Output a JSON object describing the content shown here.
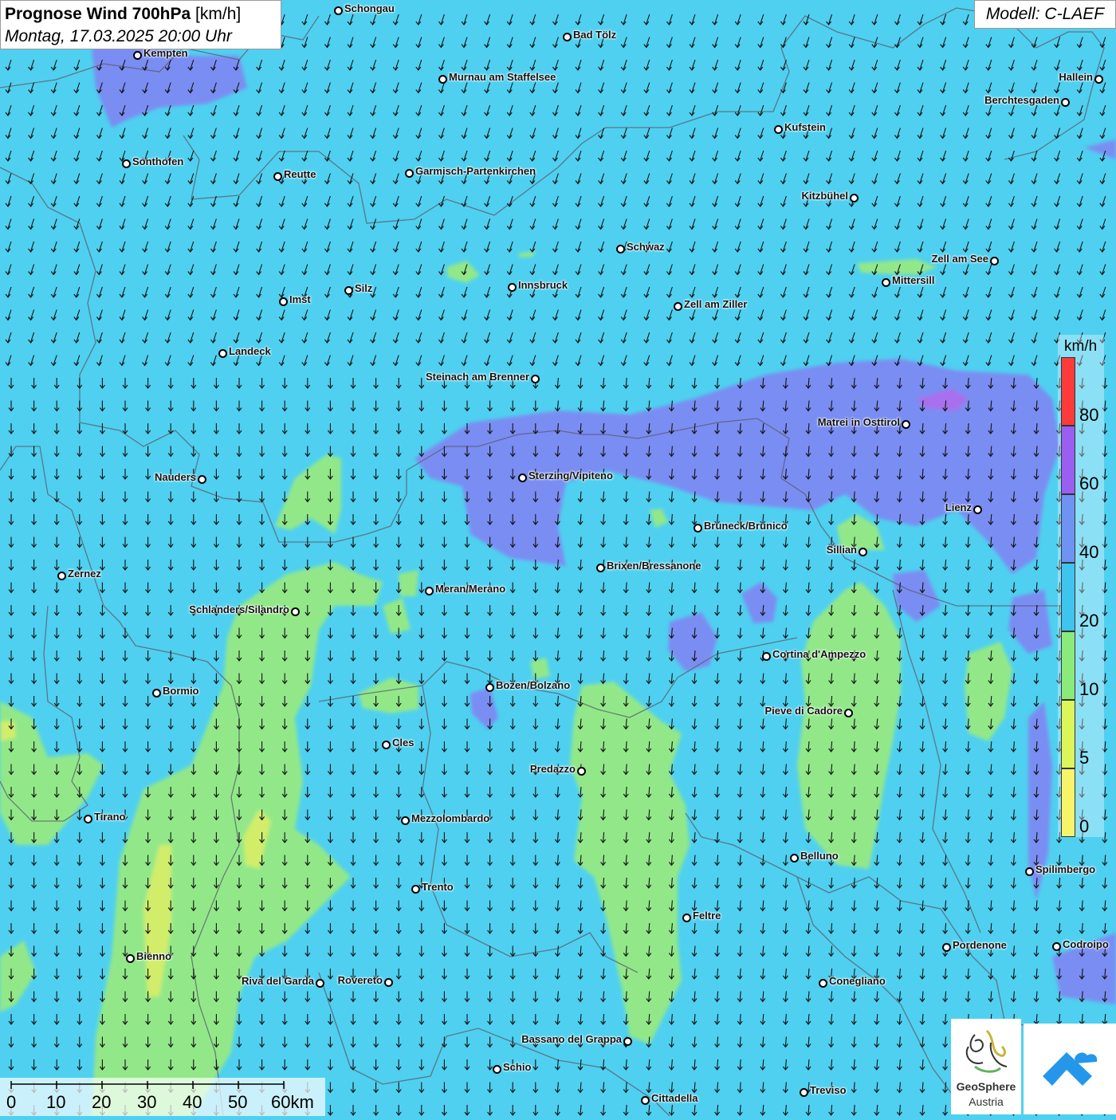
{
  "title": {
    "main": "Prognose Wind 700hPa",
    "unit": "[km/h]",
    "date": "Montag, 17.03.2025 20:00 Uhr"
  },
  "model": "Modell: C-LAEF",
  "legend": {
    "unit": "km/h",
    "ticks": [
      "80",
      "60",
      "40",
      "20",
      "10",
      "5",
      "0"
    ],
    "colors": [
      "#ff3a3a",
      "#9a5ef0",
      "#6f93f2",
      "#3fc3ef",
      "#8bea7c",
      "#dcf55a",
      "#f7f46a"
    ]
  },
  "scale_bar": {
    "labels": [
      "0",
      "10",
      "20",
      "30",
      "40",
      "50",
      "60km"
    ]
  },
  "logo": {
    "name": "GeoSphere",
    "country": "Austria"
  },
  "colors": {
    "background": "#4fd0f0",
    "field_20_40": "#4fd0f0",
    "field_10_20": "#92e889",
    "field_5_10": "#d2ed6b",
    "field_40_60": "#7a8df2",
    "field_60_80": "#a870ee",
    "brand_blue": "#2597ea"
  },
  "cities": [
    {
      "name": "Schongau"
    },
    {
      "name": "Bad Tölz"
    },
    {
      "name": "Kempten"
    },
    {
      "name": "Murnau am Staffelsee"
    },
    {
      "name": "Hallein"
    },
    {
      "name": "Berchtesgaden"
    },
    {
      "name": "Kufstein"
    },
    {
      "name": "Sonthofen"
    },
    {
      "name": "Reutte"
    },
    {
      "name": "Garmisch-Partenkirchen"
    },
    {
      "name": "Kitzbühel"
    },
    {
      "name": "Schwaz"
    },
    {
      "name": "Zell am See"
    },
    {
      "name": "Mittersill"
    },
    {
      "name": "Silz"
    },
    {
      "name": "Innsbruck"
    },
    {
      "name": "Imst"
    },
    {
      "name": "Zell am Ziller"
    },
    {
      "name": "Landeck"
    },
    {
      "name": "Steinach am Brenner"
    },
    {
      "name": "Matrei in Osttirol"
    },
    {
      "name": "Nauders"
    },
    {
      "name": "Sterzing/Vipiteno"
    },
    {
      "name": "Lienz"
    },
    {
      "name": "Bruneck/Brunico"
    },
    {
      "name": "Sillian"
    },
    {
      "name": "Brixen/Bressanone"
    },
    {
      "name": "Zernez"
    },
    {
      "name": "Meran/Merano"
    },
    {
      "name": "Schlanders/Silandro"
    },
    {
      "name": "Cortina d'Ampezzo"
    },
    {
      "name": "Bozen/Bolzano"
    },
    {
      "name": "Bormio"
    },
    {
      "name": "Pieve di Cadore"
    },
    {
      "name": "Cles"
    },
    {
      "name": "Predazzo"
    },
    {
      "name": "Tirano"
    },
    {
      "name": "Mezzolombardo"
    },
    {
      "name": "Belluno"
    },
    {
      "name": "Spilimbergo"
    },
    {
      "name": "Trento"
    },
    {
      "name": "Feltre"
    },
    {
      "name": "Pordenone"
    },
    {
      "name": "Codroipo"
    },
    {
      "name": "Bienno"
    },
    {
      "name": "Riva del Garda"
    },
    {
      "name": "Rovereto"
    },
    {
      "name": "Conegliano"
    },
    {
      "name": "Bassano del Grappa"
    },
    {
      "name": "Schio"
    },
    {
      "name": "Treviso"
    },
    {
      "name": "Cittadella"
    }
  ]
}
